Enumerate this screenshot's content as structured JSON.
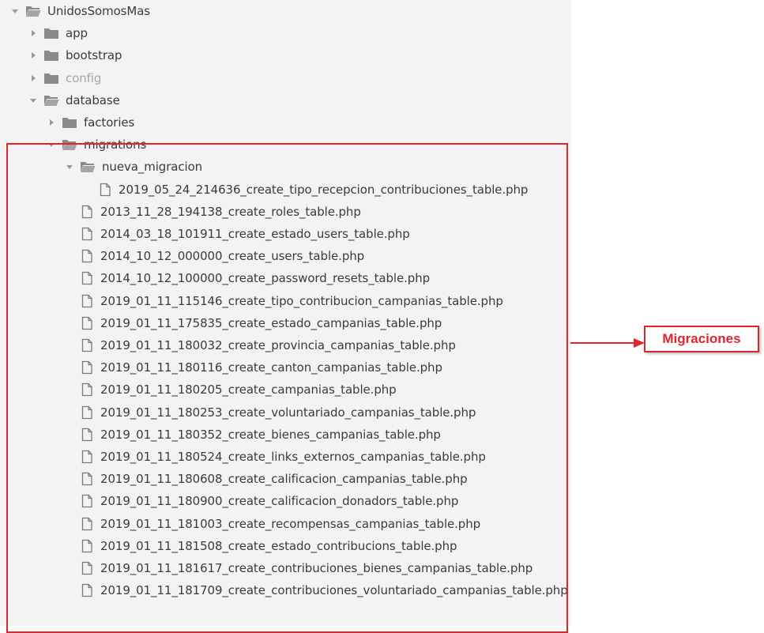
{
  "colors": {
    "panel_bg": "#f3f3f3",
    "text": "#3b3b3b",
    "dim_text": "#a6a6a6",
    "folder": "#8a8a8a",
    "highlight": "#e0262d"
  },
  "tree": [
    {
      "label": "UnidosSomosMas",
      "type": "folder",
      "expanded": true,
      "depth": 0,
      "id": "unidossomosmas"
    },
    {
      "label": "app",
      "type": "folder",
      "expanded": false,
      "depth": 1,
      "id": "app"
    },
    {
      "label": "bootstrap",
      "type": "folder",
      "expanded": false,
      "depth": 1,
      "id": "bootstrap"
    },
    {
      "label": "config",
      "type": "folder",
      "expanded": false,
      "depth": 1,
      "id": "config",
      "dim": true
    },
    {
      "label": "database",
      "type": "folder",
      "expanded": true,
      "depth": 1,
      "id": "database"
    },
    {
      "label": "factories",
      "type": "folder",
      "expanded": false,
      "depth": 2,
      "id": "factories"
    },
    {
      "label": "migrations",
      "type": "folder",
      "expanded": true,
      "depth": 2,
      "id": "migrations"
    },
    {
      "label": "nueva_migracion",
      "type": "folder",
      "expanded": true,
      "depth": 3,
      "id": "nueva-migracion"
    },
    {
      "label": "2019_05_24_214636_create_tipo_recepcion_contribuciones_table.php",
      "type": "file",
      "depth": 4
    },
    {
      "label": "2013_11_28_194138_create_roles_table.php",
      "type": "file",
      "depth": 3
    },
    {
      "label": "2014_03_18_101911_create_estado_users_table.php",
      "type": "file",
      "depth": 3
    },
    {
      "label": "2014_10_12_000000_create_users_table.php",
      "type": "file",
      "depth": 3
    },
    {
      "label": "2014_10_12_100000_create_password_resets_table.php",
      "type": "file",
      "depth": 3
    },
    {
      "label": "2019_01_11_115146_create_tipo_contribucion_campanias_table.php",
      "type": "file",
      "depth": 3
    },
    {
      "label": "2019_01_11_175835_create_estado_campanias_table.php",
      "type": "file",
      "depth": 3
    },
    {
      "label": "2019_01_11_180032_create_provincia_campanias_table.php",
      "type": "file",
      "depth": 3
    },
    {
      "label": "2019_01_11_180116_create_canton_campanias_table.php",
      "type": "file",
      "depth": 3
    },
    {
      "label": "2019_01_11_180205_create_campanias_table.php",
      "type": "file",
      "depth": 3
    },
    {
      "label": "2019_01_11_180253_create_voluntariado_campanias_table.php",
      "type": "file",
      "depth": 3
    },
    {
      "label": "2019_01_11_180352_create_bienes_campanias_table.php",
      "type": "file",
      "depth": 3
    },
    {
      "label": "2019_01_11_180524_create_links_externos_campanias_table.php",
      "type": "file",
      "depth": 3
    },
    {
      "label": "2019_01_11_180608_create_calificacion_campanias_table.php",
      "type": "file",
      "depth": 3
    },
    {
      "label": "2019_01_11_180900_create_calificacion_donadors_table.php",
      "type": "file",
      "depth": 3
    },
    {
      "label": "2019_01_11_181003_create_recompensas_campanias_table.php",
      "type": "file",
      "depth": 3
    },
    {
      "label": "2019_01_11_181508_create_estado_contribucions_table.php",
      "type": "file",
      "depth": 3
    },
    {
      "label": "2019_01_11_181617_create_contribuciones_bienes_campanias_table.php",
      "type": "file",
      "depth": 3
    },
    {
      "label": "2019_01_11_181709_create_contribuciones_voluntariado_campanias_table.php",
      "type": "file",
      "depth": 3
    }
  ],
  "callout": {
    "label": "Migraciones"
  }
}
